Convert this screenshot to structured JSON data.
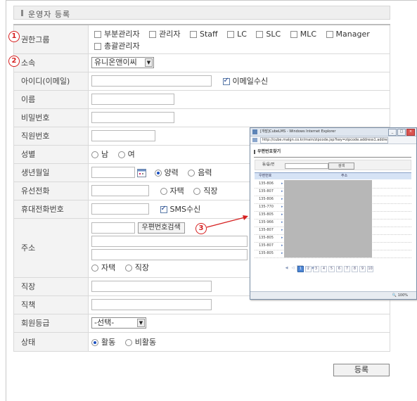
{
  "page_title": "운영자 등록",
  "fields": {
    "group": {
      "label": "권한그룹",
      "options": [
        {
          "label": "부분관리자",
          "checked": false
        },
        {
          "label": "관리자",
          "checked": false
        },
        {
          "label": "Staff",
          "checked": false
        },
        {
          "label": "LC",
          "checked": false
        },
        {
          "label": "SLC",
          "checked": false
        },
        {
          "label": "MLC",
          "checked": false
        },
        {
          "label": "Manager",
          "checked": false
        },
        {
          "label": "총괄관리자",
          "checked": false
        }
      ]
    },
    "affiliation": {
      "label": "소속",
      "selected": "유니온앤이씨"
    },
    "user_id": {
      "label": "아이디(이메일)",
      "value": "",
      "email_consent_label": "이메일수신",
      "email_consent_checked": true
    },
    "name": {
      "label": "이름",
      "value": ""
    },
    "password": {
      "label": "비밀번호",
      "value": ""
    },
    "employee_no": {
      "label": "직원번호",
      "value": ""
    },
    "gender": {
      "label": "성별",
      "options": [
        {
          "label": "남",
          "checked": false
        },
        {
          "label": "여",
          "checked": false
        }
      ]
    },
    "birthday": {
      "label": "생년월일",
      "value": "",
      "options": [
        {
          "label": "양력",
          "checked": true
        },
        {
          "label": "음력",
          "checked": false
        }
      ]
    },
    "landline": {
      "label": "유선전화",
      "value": "",
      "options": [
        {
          "label": "자택",
          "checked": false
        },
        {
          "label": "직장",
          "checked": false
        }
      ]
    },
    "mobile": {
      "label": "휴대전화번호",
      "value": "",
      "sms_label": "SMS수신",
      "sms_checked": true
    },
    "address": {
      "label": "주소",
      "zip_search_label": "우편번호검색",
      "options": [
        {
          "label": "자택",
          "checked": false
        },
        {
          "label": "직장",
          "checked": false
        }
      ]
    },
    "workplace": {
      "label": "직장",
      "value": ""
    },
    "position": {
      "label": "직책",
      "value": ""
    },
    "member_grade": {
      "label": "회원등급",
      "selected": "-선택-"
    },
    "status": {
      "label": "상태",
      "options": [
        {
          "label": "활동",
          "checked": true
        },
        {
          "label": "비활동",
          "checked": false
        }
      ]
    }
  },
  "register_button": "등록",
  "callouts": [
    "1",
    "2",
    "3"
  ],
  "popup": {
    "window_title": "[개발]CubeLMS - Windows Internet Explorer",
    "address": "http://cube.malgn.co.kr/main/zipcode.jsp?key=zipcode.address1.address2",
    "heading": "우편번호찾기",
    "search_label": "동/읍/면",
    "search_button": "검색",
    "col_zip": "우편번호",
    "col_addr": "주소",
    "rows": [
      "135-806",
      "135-807",
      "135-806",
      "135-770",
      "135-805",
      "135-966",
      "135-807",
      "135-805",
      "135-807",
      "135-805"
    ],
    "pages": [
      "1",
      "2",
      "3",
      "4",
      "5",
      "6",
      "7",
      "8",
      "9",
      "10"
    ],
    "zoom": "100%",
    "colors": {
      "accent": "#4d86d6",
      "callout": "#d62020"
    }
  }
}
